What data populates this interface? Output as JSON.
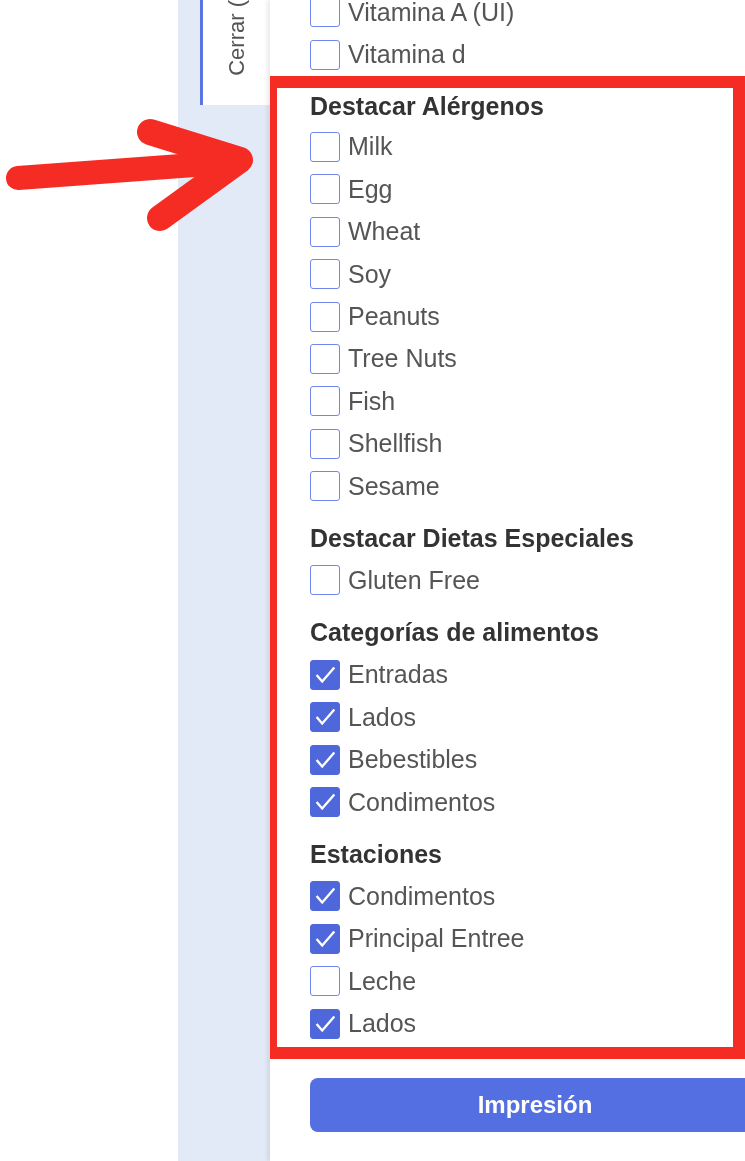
{
  "side_tab": {
    "label": "Cerrar ("
  },
  "top_items": [
    {
      "label": "Vitamina A (UI)",
      "checked": false
    },
    {
      "label": "Vitamina d",
      "checked": false
    }
  ],
  "sections": [
    {
      "title": "Destacar Alérgenos",
      "items": [
        {
          "label": "Milk",
          "checked": false
        },
        {
          "label": "Egg",
          "checked": false
        },
        {
          "label": "Wheat",
          "checked": false
        },
        {
          "label": "Soy",
          "checked": false
        },
        {
          "label": "Peanuts",
          "checked": false
        },
        {
          "label": "Tree Nuts",
          "checked": false
        },
        {
          "label": "Fish",
          "checked": false
        },
        {
          "label": "Shellfish",
          "checked": false
        },
        {
          "label": "Sesame",
          "checked": false
        }
      ]
    },
    {
      "title": "Destacar Dietas Especiales",
      "items": [
        {
          "label": "Gluten Free",
          "checked": false
        }
      ]
    },
    {
      "title": "Categorías de alimentos",
      "items": [
        {
          "label": "Entradas",
          "checked": true
        },
        {
          "label": "Lados",
          "checked": true
        },
        {
          "label": "Bebestibles",
          "checked": true
        },
        {
          "label": "Condimentos",
          "checked": true
        }
      ]
    },
    {
      "title": "Estaciones",
      "items": [
        {
          "label": "Condimentos",
          "checked": true
        },
        {
          "label": "Principal Entree",
          "checked": true
        },
        {
          "label": "Leche",
          "checked": false
        },
        {
          "label": "Lados",
          "checked": true
        }
      ]
    }
  ],
  "print_button": {
    "label": "Impresión"
  }
}
